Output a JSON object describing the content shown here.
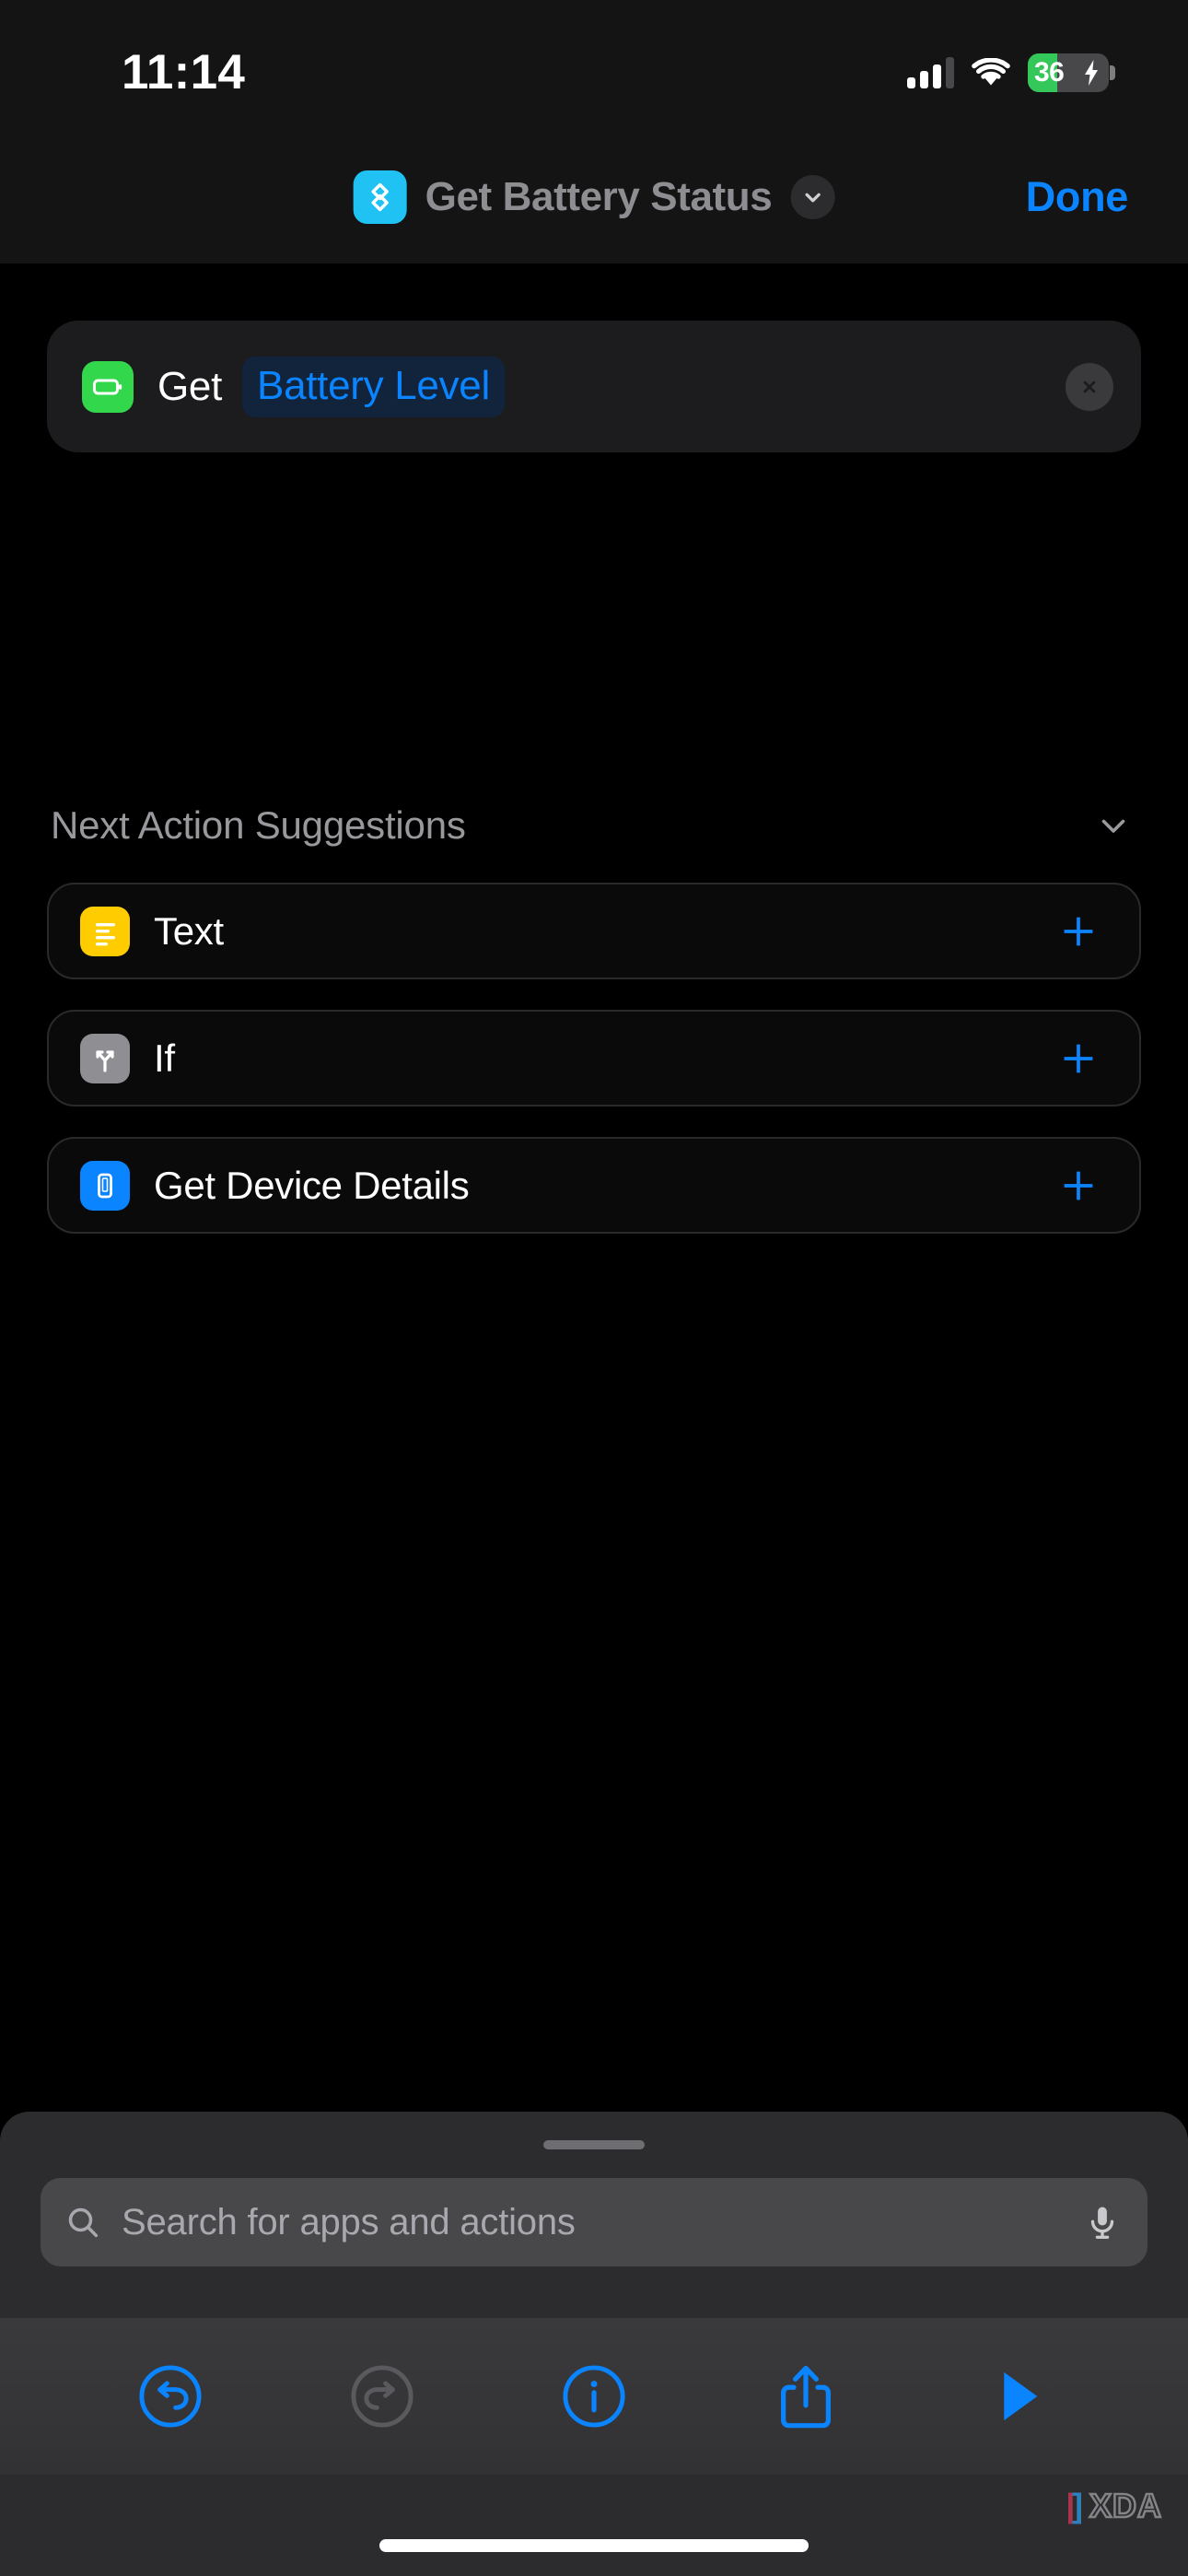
{
  "status_bar": {
    "time": "11:14",
    "cellular_icon": "cellular-bars-icon",
    "cellular_bars_active": 3,
    "cellular_bars_total": 4,
    "wifi_icon": "wifi-icon",
    "battery": {
      "percent_label": "36",
      "level": 36,
      "charging": true,
      "fill_color": "#34c759",
      "bolt_icon": "charging-bolt-icon"
    }
  },
  "nav_bar": {
    "app_icon": "shortcuts-app-icon",
    "title": "Get Battery Status",
    "chevron_icon": "chevron-down-icon",
    "done_label": "Done",
    "accent_color": "#0a84ff"
  },
  "action": {
    "icon": "battery-icon",
    "icon_color": "#32d74b",
    "verb": "Get",
    "variable": "Battery Level",
    "variable_color": "#0a84ff",
    "close_icon": "close-x-icon"
  },
  "suggestions": {
    "title": "Next Action Suggestions",
    "collapse_icon": "chevron-down-icon",
    "items": [
      {
        "label": "Text",
        "icon": "text-lines-icon",
        "icon_color": "#ffcc00",
        "add_icon": "plus-icon"
      },
      {
        "label": "If",
        "icon": "branch-arrows-icon",
        "icon_color": "#8e8e93",
        "add_icon": "plus-icon"
      },
      {
        "label": "Get Device Details",
        "icon": "device-phone-icon",
        "icon_color": "#0a84ff",
        "add_icon": "plus-icon"
      }
    ]
  },
  "bottom_sheet": {
    "grabber": "sheet-grabber",
    "search": {
      "placeholder": "Search for apps and actions",
      "value": "",
      "search_icon": "search-icon",
      "mic_icon": "microphone-icon"
    }
  },
  "toolbar": {
    "items": [
      {
        "name": "undo-button",
        "icon": "undo-arrow-icon",
        "enabled": true
      },
      {
        "name": "redo-button",
        "icon": "redo-arrow-icon",
        "enabled": false
      },
      {
        "name": "info-button",
        "icon": "info-circle-icon",
        "enabled": true
      },
      {
        "name": "share-button",
        "icon": "share-square-arrow-icon",
        "enabled": true
      },
      {
        "name": "run-button",
        "icon": "play-triangle-icon",
        "enabled": true
      }
    ]
  },
  "watermark": {
    "bracket_left": "[",
    "bracket_right": "]",
    "word": "XDA"
  }
}
